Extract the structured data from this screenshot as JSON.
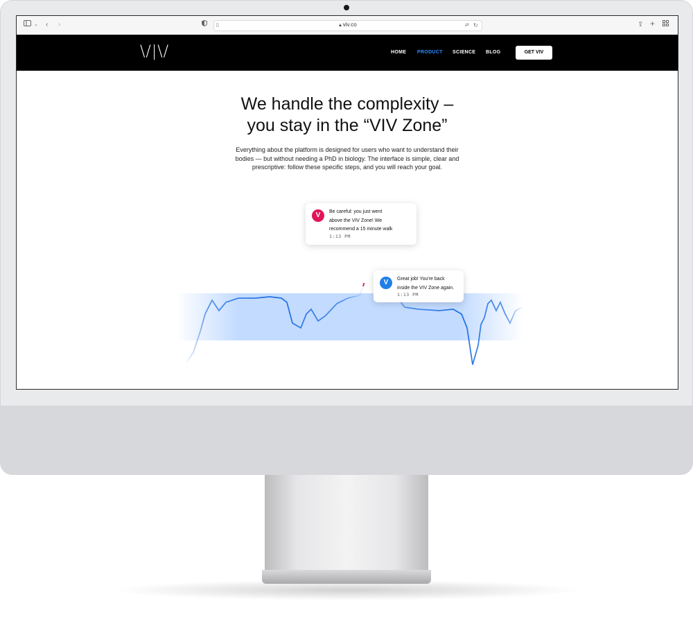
{
  "browser": {
    "url": "viv.co"
  },
  "site": {
    "logo": "\\/|\\/",
    "nav": [
      {
        "label": "HOME",
        "active": false
      },
      {
        "label": "PRODUCT",
        "active": true
      },
      {
        "label": "SCIENCE",
        "active": false
      },
      {
        "label": "BLOG",
        "active": false
      }
    ],
    "cta": "GET VIV",
    "accent": "#2b8cff"
  },
  "hero": {
    "title_line1": "We handle the complexity –",
    "title_line2": "you stay in the “VIV Zone”",
    "body": "Everything about the platform is designed for users who want to understand their bodies — but without needing a PhD in biology. The interface is simple, clear and prescriptive: follow these specific steps, and you will reach your goal."
  },
  "notifications": [
    {
      "avatar": "V",
      "color": "#e0145a",
      "lines": [
        "Be careful: you just went",
        "above the VIV Zone! We",
        "recommend a 15 minute walk"
      ],
      "time": "1:13 PM"
    },
    {
      "avatar": "V",
      "color": "#1f7fe8",
      "lines": [
        "Great job! You're back",
        "inside the VIV Zone again."
      ],
      "time": "1:13 PM"
    }
  ],
  "icons": {
    "sidebar": "sidebar-icon",
    "back": "chevron-left-icon",
    "forward": "chevron-right-icon",
    "shield": "shield-icon",
    "lock": "lock-icon",
    "translate": "translate-icon",
    "reload": "reload-icon",
    "share": "share-icon",
    "new_tab": "plus-icon",
    "tabs": "tab-overview-icon"
  }
}
